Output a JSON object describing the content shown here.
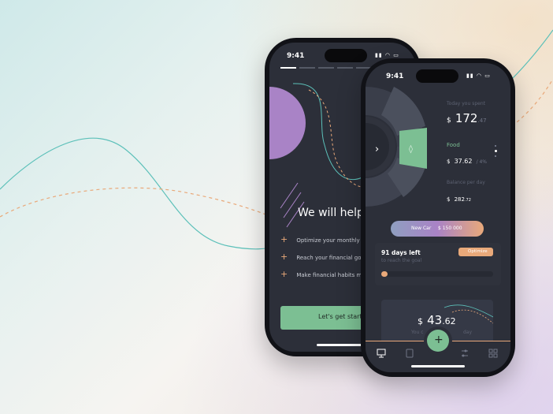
{
  "back_phone": {
    "time": "9:41",
    "headline": "We will help",
    "features": [
      {
        "label": "Optimize your monthly co"
      },
      {
        "label": "Reach your financial goals"
      },
      {
        "label": "Make financial habits mon"
      }
    ],
    "cta_label": "Let's get starte"
  },
  "front_phone": {
    "time": "9:41",
    "today": {
      "label": "Today you spent",
      "currency": "$",
      "amount": "172",
      "cents": ".47"
    },
    "category": {
      "label": "Food",
      "currency": "$",
      "amount": "37.62",
      "of": "/ 4%"
    },
    "balance": {
      "label": "Balance per day",
      "currency": "$",
      "amount": "282",
      "cents": ".72"
    },
    "goal": {
      "name": "New Car",
      "amount": "$ 150 000"
    },
    "days_left": "91 days left",
    "days_sub": "to reach the goal",
    "optimize_label": "Optimize",
    "daily": {
      "currency": "$",
      "amount": "43",
      "cents": ".62",
      "sub_left": "You c",
      "sub_right": "day"
    },
    "fab_label": "+",
    "tabs": [
      {
        "icon": "monitor-icon"
      },
      {
        "icon": "document-icon"
      },
      {
        "icon": "sliders-icon"
      },
      {
        "icon": "grid-icon"
      }
    ]
  },
  "colors": {
    "accent_green": "#7cbf93",
    "accent_purple": "#a983c6",
    "accent_orange": "#e9a97a",
    "teal_line": "#5cc0b9"
  }
}
